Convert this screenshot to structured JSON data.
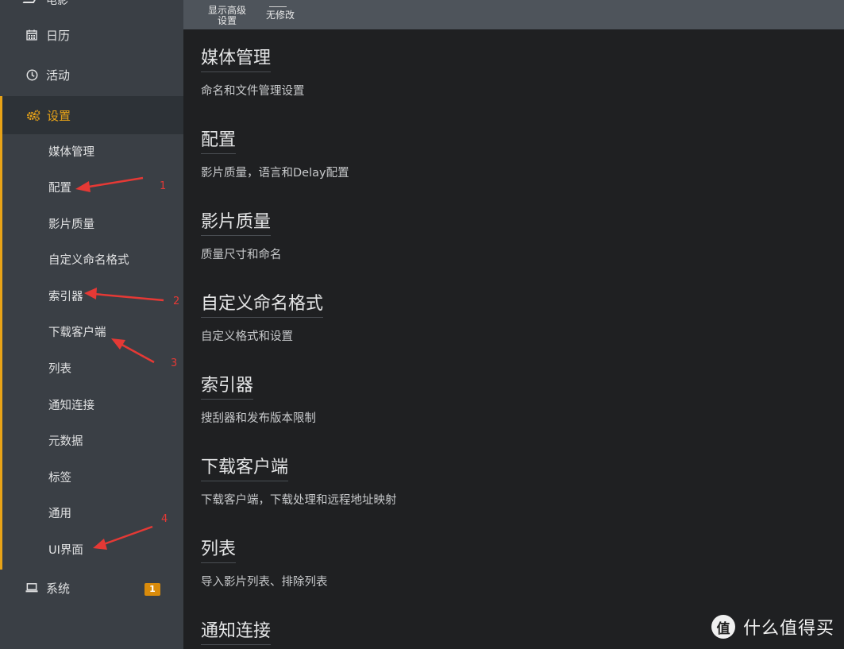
{
  "sidebar": {
    "partial_top": {
      "label": "电影",
      "icon": "film-icon"
    },
    "calendar": {
      "label": "日历",
      "icon": "calendar-icon"
    },
    "activity": {
      "label": "活动",
      "icon": "clock-icon"
    },
    "settings": {
      "label": "设置",
      "icon": "gears-icon",
      "items": [
        {
          "label": "媒体管理"
        },
        {
          "label": "配置"
        },
        {
          "label": "影片质量"
        },
        {
          "label": "自定义命名格式"
        },
        {
          "label": "索引器"
        },
        {
          "label": "下载客户端"
        },
        {
          "label": "列表"
        },
        {
          "label": "通知连接"
        },
        {
          "label": "元数据"
        },
        {
          "label": "标签"
        },
        {
          "label": "通用"
        },
        {
          "label": "UI界面"
        }
      ]
    },
    "system": {
      "label": "系统",
      "icon": "laptop-icon",
      "badge": "1"
    }
  },
  "toolbar": {
    "show_advanced": {
      "line1": "显示高级",
      "line2": "设置"
    },
    "no_changes": {
      "label": "无修改"
    }
  },
  "sections": [
    {
      "title": "媒体管理",
      "desc": "命名和文件管理设置"
    },
    {
      "title": "配置",
      "desc": "影片质量，语言和Delay配置"
    },
    {
      "title": "影片质量",
      "desc": "质量尺寸和命名"
    },
    {
      "title": "自定义命名格式",
      "desc": "自定义格式和设置"
    },
    {
      "title": "索引器",
      "desc": "搜刮器和发布版本限制"
    },
    {
      "title": "下载客户端",
      "desc": "下载客户端，下载处理和远程地址映射"
    },
    {
      "title": "列表",
      "desc": "导入影片列表、排除列表"
    },
    {
      "title": "通知连接",
      "desc": ""
    }
  ],
  "annotations": [
    "1",
    "2",
    "3",
    "4"
  ],
  "watermark": {
    "logo": "值",
    "text": "什么值得买"
  },
  "colors": {
    "accent": "#e8a317",
    "sidebar_bg": "#3a3f45",
    "content_bg": "#1f2022",
    "toolbar_bg": "#4e545b",
    "badge": "#d98b0b",
    "arrow": "#e53935"
  }
}
